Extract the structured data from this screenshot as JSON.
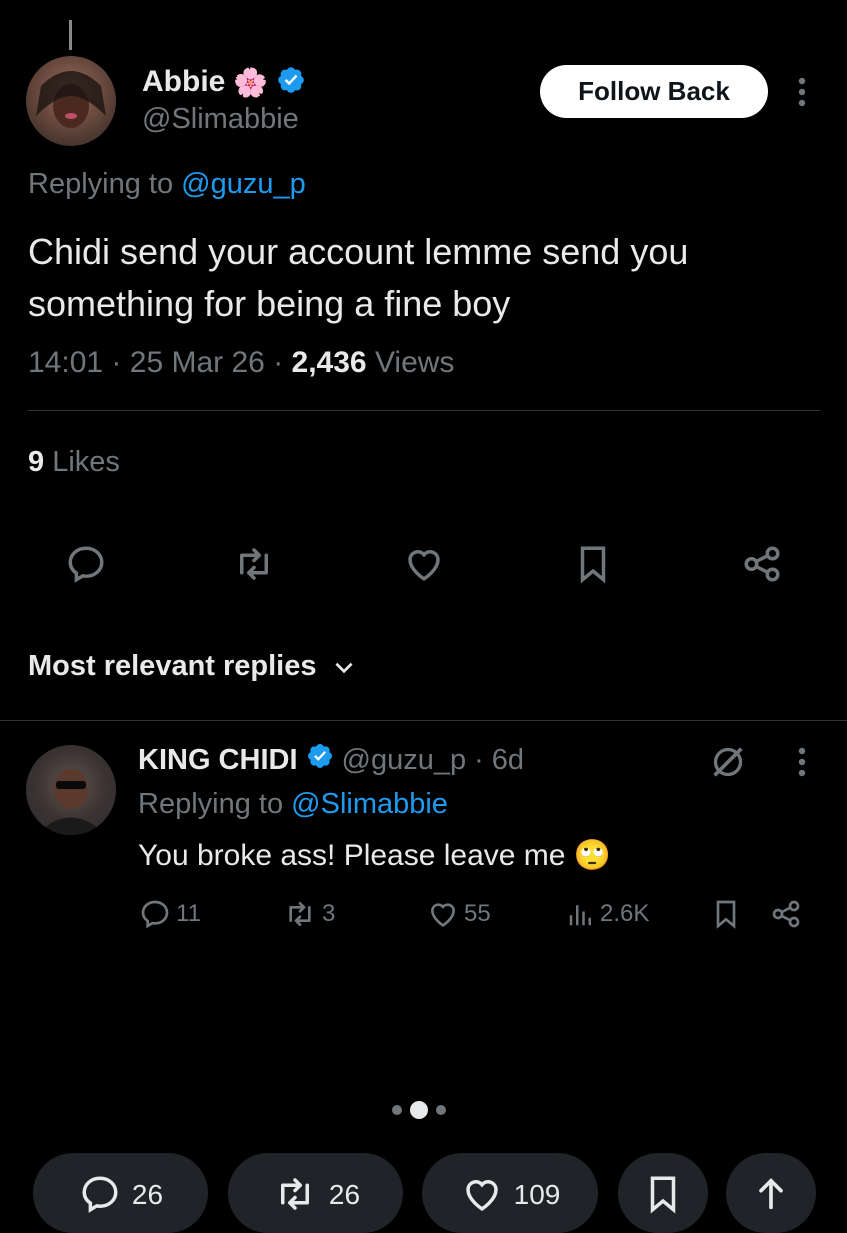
{
  "tweet": {
    "author_name": "Abbie",
    "author_emoji": "🌸",
    "author_handle": "@Slimabbie",
    "follow_label": "Follow Back",
    "reply_prefix": "Replying to",
    "reply_to": "@guzu_p",
    "text_line1": "Chidi send your account lemme send you",
    "text_line2": "something for being a fine boy",
    "time": "14:01",
    "date": "25 Mar 26",
    "views_count": "2,436",
    "views_label": "Views",
    "likes_count": "9",
    "likes_label": "Likes"
  },
  "replies_sort_label": "Most relevant replies",
  "reply": {
    "author_name": "KING CHIDI",
    "author_handle": "@guzu_p",
    "age": "6d",
    "reply_prefix": "Replying to",
    "reply_to": "@Slimabbie",
    "text": "You broke ass! Please leave me",
    "emoji": "🙄",
    "comments": "11",
    "reposts": "3",
    "likes": "55",
    "views": "2.6K"
  },
  "carousel": {
    "pages": 3,
    "active": 1
  },
  "bottom_bar": {
    "comments": "26",
    "reposts": "26",
    "likes": "109"
  },
  "colors": {
    "background": "#000000",
    "accent": "#1d9bf0",
    "muted": "#71767b",
    "divider": "#2f3336"
  }
}
